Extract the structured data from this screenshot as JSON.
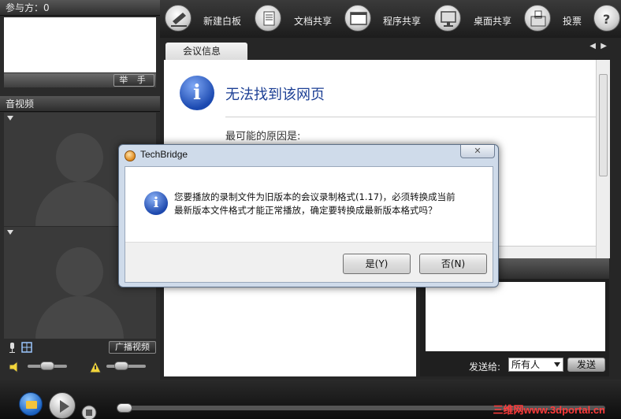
{
  "left": {
    "participants_label": "参与方：0",
    "raise_hand_label": "举 手",
    "av_label": "音视频",
    "broadcast_label": "广播视频"
  },
  "toolbar": {
    "whiteboard": "新建白板",
    "doc_share": "文档共享",
    "app_share": "程序共享",
    "desktop_share": "桌面共享",
    "vote": "投票"
  },
  "tabs": {
    "meeting_info": "会议信息"
  },
  "browser": {
    "error_title": "无法找到该网页",
    "reason_label": "最可能的原因是:"
  },
  "chat": {
    "send_to_label": "发送给:",
    "send_to_value": "所有人",
    "send_button": "发送"
  },
  "dialog": {
    "title": "TechBridge",
    "close_glyph": "✕",
    "message_line1": "您要播放的录制文件为旧版本的会议录制格式(1.17)，必须转换成当前",
    "message_line2": "最新版本文件格式才能正常播放，确定要转换成最新版本格式吗？",
    "yes_label": "是(Y)",
    "no_label": "否(N)"
  },
  "watermark": "三维网www.3dportal.cn",
  "colors": {
    "dialog_frame": "#cfdbea",
    "error_title": "#1c3f94",
    "watermark": "#ff3b3b"
  }
}
